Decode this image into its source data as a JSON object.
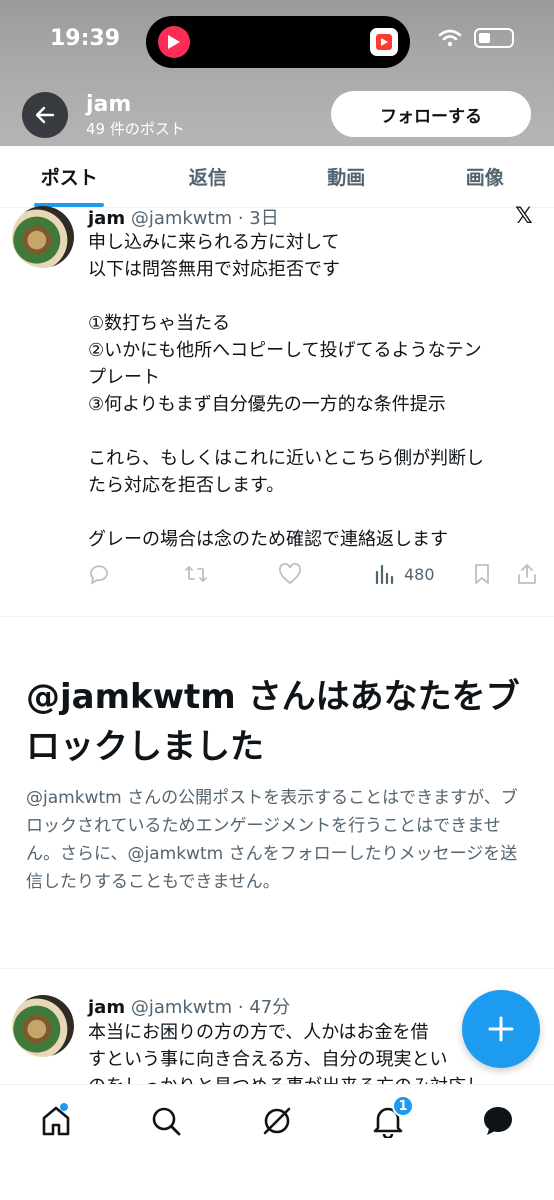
{
  "status_bar": {
    "time": "19:39"
  },
  "header": {
    "name": "jam",
    "post_count": "49 件のポスト",
    "follow_label": "フォローする"
  },
  "tabs": [
    {
      "label": "ポスト",
      "active": true
    },
    {
      "label": "返信",
      "active": false
    },
    {
      "label": "動画",
      "active": false
    },
    {
      "label": "画像",
      "active": false
    }
  ],
  "post1": {
    "name": "jam",
    "meta": "@jamkwtm · 3日",
    "lines": [
      "申し込みに来られる方に対して",
      "以下は問答無用で対応拒否です",
      "",
      "①数打ちゃ当たる",
      "②いかにも他所へコピーして投げてるようなテン",
      "プレート",
      "③何よりもまず自分優先の一方的な条件提示",
      "",
      "これら、もしくはこれに近いとこちら側が判断し",
      "たら対応を拒否します。",
      "",
      "グレーの場合は念のため確認で連絡返します"
    ],
    "views": "480"
  },
  "blocked": {
    "title": "@jamkwtm さんはあなたをブロックしました",
    "description": "@jamkwtm さんの公開ポストを表示することはできますが、ブロックされているためエンゲージメントを行うことはできません。さらに、@jamkwtm さんをフォローしたりメッセージを送信したりすることもできません。"
  },
  "post2": {
    "name": "jam",
    "meta": "@jamkwtm · 47分",
    "lines": [
      "本当にお困りの方の方で、人かはお金を借",
      "すという事に向き合える方、自分の現実とい",
      "のをしっかりと見つめる事が出来る方のみ対応し"
    ]
  },
  "bottom_nav": {
    "notification_count": "1"
  },
  "colors": {
    "accent": "#1d9bf0",
    "text": "#0f1419",
    "muted": "#536471"
  }
}
